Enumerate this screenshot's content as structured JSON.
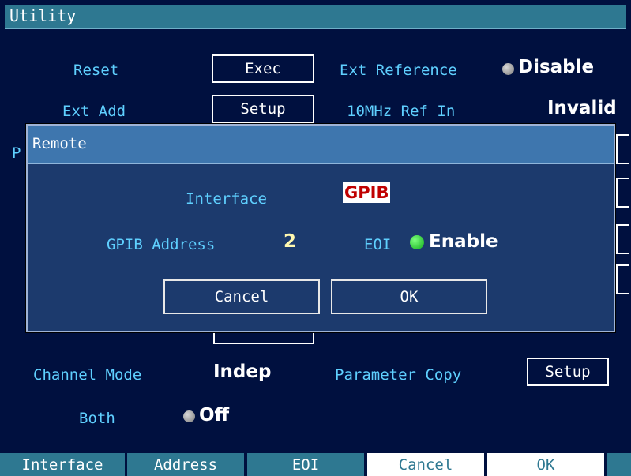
{
  "window": {
    "title": "Utility"
  },
  "utility": {
    "reset_label": "Reset",
    "reset_button": "Exec",
    "ext_reference_label": "Ext Reference",
    "ext_reference_value": "Disable",
    "ext_add_label": "Ext Add",
    "ext_add_button": "Setup",
    "ref_in_label": "10MHz Ref In",
    "ref_in_value": "Invalid",
    "p_partial": "P",
    "channel_mode_label": "Channel Mode",
    "channel_mode_value": "Indep",
    "parameter_copy_label": "Parameter Copy",
    "parameter_copy_button": "Setup",
    "both_label": "Both",
    "both_value": "Off"
  },
  "dialog": {
    "title": "Remote",
    "interface_label": "Interface",
    "interface_value": "GPIB",
    "gpib_address_label": "GPIB Address",
    "gpib_address_value": "2",
    "eoi_label": "EOI",
    "eoi_value": "Enable",
    "cancel_label": "Cancel",
    "ok_label": "OK"
  },
  "softkeys": [
    "Interface",
    "Address",
    "EOI",
    "Cancel",
    "OK"
  ],
  "colors": {
    "background": "#00103f",
    "title_bar": "#2e7891",
    "dialog_body": "#1c3a6d",
    "dialog_title": "#3e76ae",
    "label_text": "#5fd0ff",
    "gpib_text": "#c00000",
    "enable_led": "#19c62a"
  },
  "icons": {
    "ext_reference_status": "gray-led-icon",
    "both_status": "gray-led-icon",
    "eoi_status": "green-led-icon"
  }
}
